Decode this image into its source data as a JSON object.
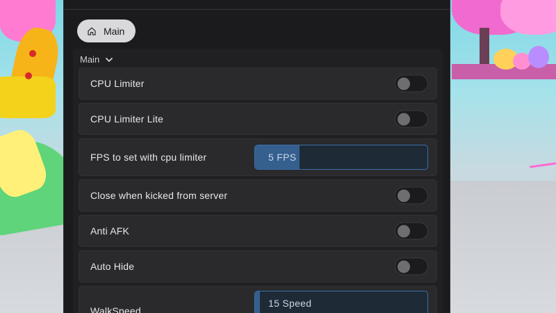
{
  "tabs": {
    "main_label": "Main",
    "icon": "home-icon"
  },
  "section": {
    "title": "Main",
    "chevron": "chevron-down-icon"
  },
  "rows": [
    {
      "label": "CPU Limiter",
      "type": "toggle",
      "on": false
    },
    {
      "label": "CPU Limiter Lite",
      "type": "toggle",
      "on": false
    },
    {
      "label": "FPS to set with cpu limiter",
      "type": "slider",
      "value_text": "5 FPS",
      "fill_fraction": 0.26
    },
    {
      "label": "Close when kicked from server",
      "type": "toggle",
      "on": false
    },
    {
      "label": "Anti AFK",
      "type": "toggle",
      "on": false
    },
    {
      "label": "Auto Hide",
      "type": "toggle",
      "on": false
    },
    {
      "label": "WalkSpeed",
      "type": "slider",
      "value_text": "15 Speed",
      "fill_fraction": 0.03
    }
  ],
  "colors": {
    "panel_bg": "#1b1b1d",
    "row_bg": "#2a2a2d",
    "slider_accent": "#355f8e",
    "slider_border": "#3a6fa8",
    "tab_bg": "#d9d9db"
  }
}
